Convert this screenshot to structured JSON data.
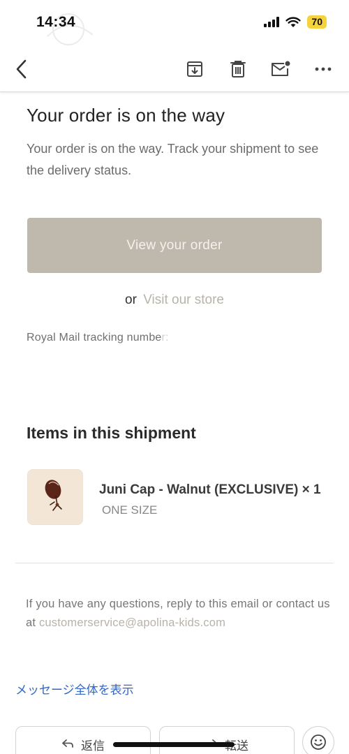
{
  "status_bar": {
    "time": "14:34",
    "battery": "70",
    "battery_color": "#f6d33c"
  },
  "watermark_text": "Apolina",
  "toolbar": {
    "back_icon": "chevron-left-icon",
    "archive_icon": "archive-icon",
    "trash_icon": "trash-icon",
    "mark_unread_icon": "mail-unread-icon",
    "more_icon": "more-horizontal-icon"
  },
  "email": {
    "headline": "Your order is on the way",
    "body": "Your order is on the way. Track your shipment to see the delivery status.",
    "cta_label": "View your order",
    "or_text": "or",
    "store_link": "Visit our store",
    "tracking_label": "Royal Mail tracking numbe",
    "tracking_faded": "r:",
    "items_title": "Items in this shipment",
    "items": [
      {
        "name": "Juni Cap - Walnut (EXCLUSIVE) × 1",
        "size": "ONE SIZE"
      }
    ],
    "footer_text": "If you have any questions, reply to this email or contact us at",
    "footer_email": "customerservice@apolina-kids.com"
  },
  "show_all_label": "メッセージ全体を表示",
  "actions": {
    "reply_label": "返信",
    "forward_label": "転送",
    "emoji_icon": "smiley-icon"
  },
  "colors": {
    "cta_background": "#bfb8ad",
    "link_color": "#2f66c8",
    "muted_link": "#b8b3a9"
  }
}
